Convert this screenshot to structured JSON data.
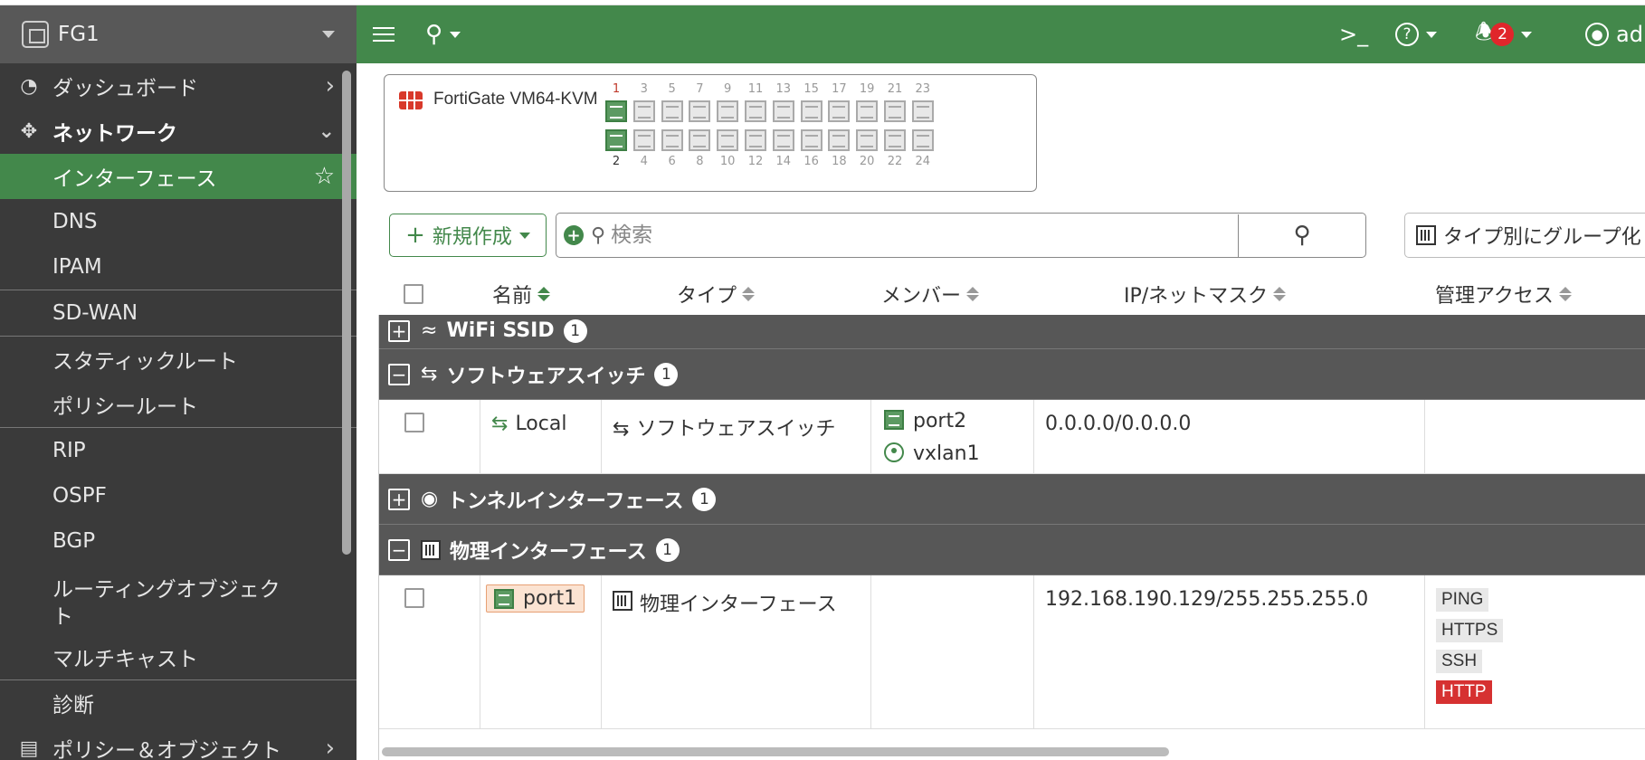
{
  "sidebar": {
    "device_name": "FG1",
    "items": [
      {
        "label": "ダッシュボード"
      },
      {
        "label": "ネットワーク"
      },
      {
        "label": "インターフェース"
      },
      {
        "label": "DNS"
      },
      {
        "label": "IPAM"
      },
      {
        "label": "SD-WAN"
      },
      {
        "label": "スタティックルート"
      },
      {
        "label": "ポリシールート"
      },
      {
        "label": "RIP"
      },
      {
        "label": "OSPF"
      },
      {
        "label": "BGP"
      },
      {
        "label": "ルーティングオブジェクト"
      },
      {
        "label": "マルチキャスト"
      },
      {
        "label": "診断"
      },
      {
        "label": "ポリシー＆オブジェクト"
      }
    ]
  },
  "topbar": {
    "notification_count": "2",
    "user_label": "adm",
    "brand_color": "#43884b"
  },
  "faceplate": {
    "model": "FortiGate VM64-KVM",
    "top_ports": [
      "1",
      "3",
      "5",
      "7",
      "9",
      "11",
      "13",
      "15",
      "17",
      "19",
      "21",
      "23"
    ],
    "bottom_ports": [
      "2",
      "4",
      "6",
      "8",
      "10",
      "12",
      "14",
      "16",
      "18",
      "20",
      "22",
      "24"
    ],
    "ports_up": [
      "1",
      "2"
    ]
  },
  "toolbar": {
    "new_label": "新規作成",
    "search_placeholder": "検索",
    "group_label": "タイプ別にグループ化"
  },
  "table": {
    "headers": {
      "name": "名前",
      "type": "タイプ",
      "members": "メンバー",
      "ip": "IP/ネットマスク",
      "access": "管理アクセス"
    },
    "groups": [
      {
        "label": "WiFi SSID",
        "count": "1",
        "expanded": false
      },
      {
        "label": "ソフトウェアスイッチ",
        "count": "1",
        "expanded": true
      },
      {
        "label": "トンネルインターフェース",
        "count": "1",
        "expanded": false
      },
      {
        "label": "物理インターフェース",
        "count": "1",
        "expanded": true
      }
    ],
    "rows": [
      {
        "name": "Local",
        "type": "ソフトウェアスイッチ",
        "members": [
          "port2",
          "vxlan1"
        ],
        "ip": "0.0.0.0/0.0.0.0",
        "access": []
      },
      {
        "name": "port1",
        "type": "物理インターフェース",
        "members": [],
        "ip": "192.168.190.129/255.255.255.0",
        "access": [
          "PING",
          "HTTPS",
          "SSH",
          "HTTP"
        ]
      }
    ]
  }
}
